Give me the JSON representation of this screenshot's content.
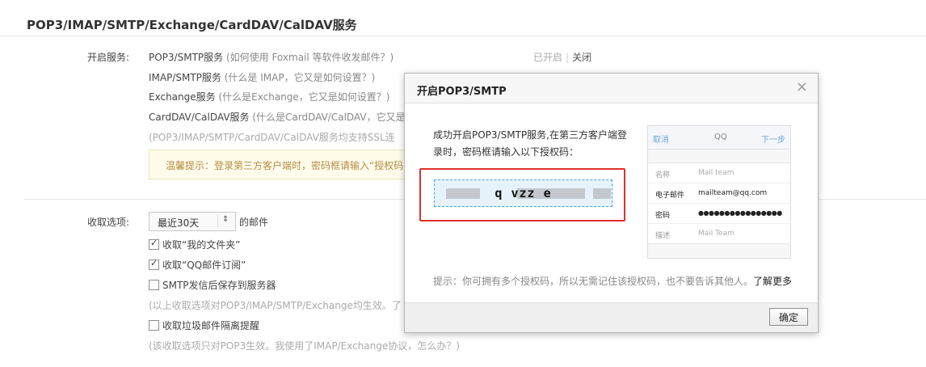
{
  "page_title": "POP3/IMAP/SMTP/Exchange/CardDAV/CalDAV服务",
  "services": {
    "label": "开启服务:",
    "items": [
      {
        "name": "POP3/SMTP服务",
        "hint": " (如何使用 Foxmail 等软件收发邮件？)"
      },
      {
        "name": "IMAP/SMTP服务",
        "hint": " (什么是 IMAP，它又是如何设置？)"
      },
      {
        "name": "Exchange服务",
        "hint": " (什么是Exchange，它又是如何设置？)"
      },
      {
        "name": "CardDAV/CalDAV服务",
        "hint": " (什么是CardDAV/CalDAV，它又是"
      }
    ],
    "ssl_note": "(POP3/IMAP/SMTP/CardDAV/CalDAV服务均支持SSL连",
    "status_on": "已开启",
    "status_off": "关闭",
    "tip": "温馨提示：登录第三方客户端时，密码框请输入“授权码"
  },
  "receive": {
    "label": "收取选项:",
    "select_value": "最近30天",
    "select_suffix": "的邮件",
    "options": [
      {
        "label": "收取“我的文件夹”",
        "checked": true
      },
      {
        "label": "收取“QQ邮件订阅”",
        "checked": true
      },
      {
        "label": "SMTP发信后保存到服务器",
        "checked": false
      },
      {
        "label": "收取垃圾邮件隔离提醒",
        "checked": false
      }
    ],
    "note1": "(以上收取选项对POP3/IMAP/SMTP/Exchange均生效。了",
    "note2": "(该收取选项只对POP3生效。我使用了IMAP/Exchange协议，怎么办？)"
  },
  "dialog": {
    "title": "开启POP3/SMTP",
    "close_glyph": "×",
    "message": "成功开启POP3/SMTP服务,在第三方客户端登录时，密码框请输入以下授权码：",
    "auth_code": "     q vzz      e   ",
    "phone": {
      "cancel": "取消",
      "center": "QQ",
      "next": "下一步",
      "rows": [
        {
          "key": "名称",
          "value": "Mail team"
        },
        {
          "key": "电子邮件",
          "value": "mailteam@qq.com"
        },
        {
          "key": "密码",
          "value": "●●●●●●●●●●●●●●●●"
        },
        {
          "key": "描述",
          "value": "Mail Team"
        }
      ]
    },
    "footer_tip": "提示：你可拥有多个授权码，所以无需记住该授权码，也不要告诉其他人。",
    "learn_more": "了解更多",
    "ok_label": "确定"
  }
}
